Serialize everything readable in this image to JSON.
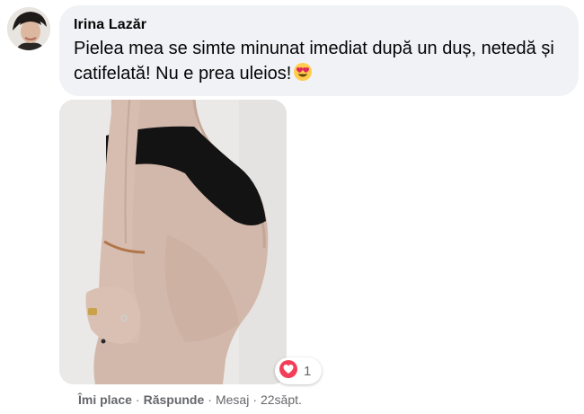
{
  "comment": {
    "author": "Irina Lazăr",
    "text": "Pielea mea se simte minunat imediat după un duș, netedă și catifelată! Nu e prea uleios!",
    "emoji": "heart-eyes-emoji",
    "reaction_icon": "love-heart-icon",
    "reaction_count": "1"
  },
  "actions": {
    "like": "Îmi place",
    "reply": "Răspunde",
    "message": "Mesaj",
    "time": "22săpt.",
    "separator": "·"
  },
  "colors": {
    "bubble": "#f0f2f5",
    "love": "#f33e58",
    "meta_text": "#65676b"
  }
}
